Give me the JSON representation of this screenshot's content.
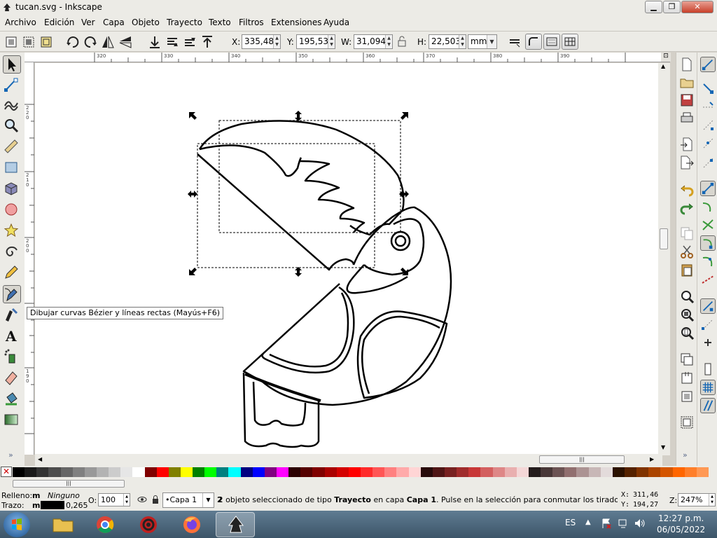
{
  "window": {
    "title": "tucan.svg - Inkscape"
  },
  "menu": [
    "Archivo",
    "Edición",
    "Ver",
    "Capa",
    "Objeto",
    "Trayecto",
    "Texto",
    "Filtros",
    "Extensiones",
    "Ayuda"
  ],
  "controls": {
    "x_label": "X:",
    "x_value": "335,480",
    "y_label": "Y:",
    "y_value": "195,532",
    "w_label": "W:",
    "w_value": "31,094",
    "h_label": "H:",
    "h_value": "22,503",
    "unit": "mm"
  },
  "ruler": {
    "h_ticks": [
      "320",
      "330",
      "340",
      "350",
      "360",
      "370",
      "380",
      "390"
    ],
    "v_ticks": [
      "220",
      "210",
      "200",
      "190"
    ]
  },
  "tooltip": "Dibujar curvas Bézier y líneas rectas (Mayús+F6)",
  "palette": {
    "none_symbol": "✕",
    "colors": [
      "#000000",
      "#1a1a1a",
      "#333333",
      "#4d4d4d",
      "#666666",
      "#808080",
      "#999999",
      "#b3b3b3",
      "#cccccc",
      "#e6e6e6",
      "#ffffff",
      "#800000",
      "#ff0000",
      "#808000",
      "#ffff00",
      "#008000",
      "#00ff00",
      "#008080",
      "#00ffff",
      "#000080",
      "#0000ff",
      "#800080",
      "#ff00ff",
      "#2b0000",
      "#550000",
      "#800000",
      "#aa0000",
      "#d40000",
      "#ff0000",
      "#ff2a2a",
      "#ff5555",
      "#ff8080",
      "#ffaaaa",
      "#ffd5d5",
      "#280b0b",
      "#501616",
      "#782121",
      "#a02c2c",
      "#c83737",
      "#d35f5f",
      "#de8787",
      "#e9afaf",
      "#f4d7d7",
      "#241c1c",
      "#483737",
      "#6c5353",
      "#916f6f",
      "#ac9393",
      "#c8b7b7",
      "#e3dbdb",
      "#2b1100",
      "#552200",
      "#803300",
      "#aa4400",
      "#d45500",
      "#ff6600",
      "#ff7f2a",
      "#ff9955"
    ]
  },
  "status": {
    "fill_label": "Relleno:",
    "fill_m": "m",
    "fill_value": "Ninguno",
    "stroke_label": "Trazo:",
    "stroke_m": "m",
    "stroke_width": "0,265",
    "opacity_label": "O:",
    "opacity_value": "100",
    "layer": "•Capa 1",
    "message_prefix": "2 objeto seleccionado de tipo ",
    "message_type": "Trayecto",
    "message_mid": " en capa ",
    "message_layer": "Capa 1",
    "message_suffix": ". Pulse en la selección para conmutar los tiradores d...",
    "cursor_x_label": "X:",
    "cursor_x": "311,46",
    "cursor_y_label": "Y:",
    "cursor_y": "194,27",
    "zoom_label": "Z:",
    "zoom_value": "247%"
  },
  "taskbar": {
    "language": "ES",
    "time": "12:27 p.m.",
    "date": "06/05/2022"
  }
}
